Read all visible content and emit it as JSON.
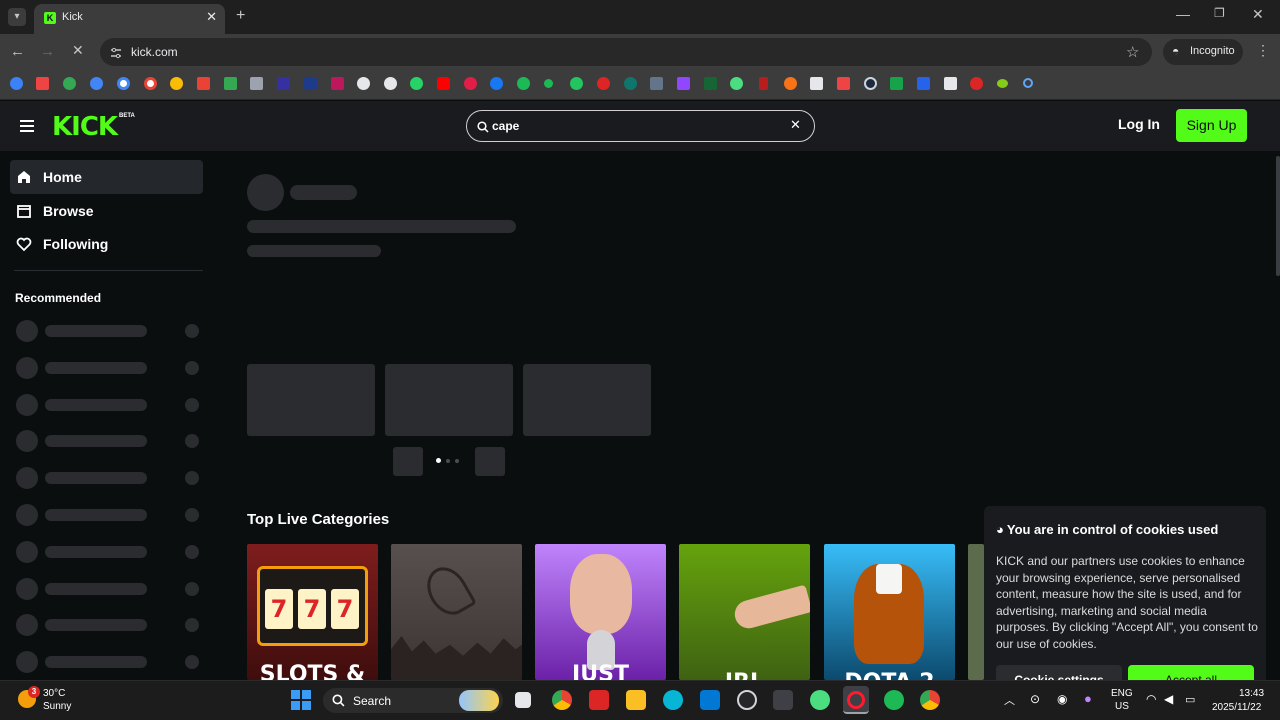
{
  "browser": {
    "tab_title": "Kick",
    "tab_favicon_letter": "K",
    "url": "kick.com",
    "incognito_label": "Incognito"
  },
  "site": {
    "logo": "KICK",
    "logo_badge": "BETA",
    "brand_color": "#53fc18",
    "search_value": "cape",
    "login_label": "Log In",
    "signup_label": "Sign Up"
  },
  "sidebar": {
    "nav": [
      {
        "label": "Home",
        "icon": "home-icon",
        "active": true
      },
      {
        "label": "Browse",
        "icon": "browse-icon",
        "active": false
      },
      {
        "label": "Following",
        "icon": "heart-icon",
        "active": false
      }
    ],
    "recommended_title": "Recommended"
  },
  "main": {
    "categories_title": "Top Live Categories",
    "categories": [
      {
        "text": "SLOTS &"
      },
      {
        "text": ""
      },
      {
        "text": "JUST"
      },
      {
        "text": "IRL"
      },
      {
        "text": "DOTA 2"
      },
      {
        "text": ""
      }
    ]
  },
  "cookie": {
    "title": "You are in control of cookies used",
    "body": "KICK and our partners use cookies to enhance your browsing experience, serve personalised content, measure how the site is used, and for advertising, marketing and social media purposes. By clicking \"Accept All\", you consent to our use of cookies.",
    "settings_label": "Cookie settings",
    "accept_label": "Accept all"
  },
  "taskbar": {
    "weather_temp": "30°C",
    "weather_desc": "Sunny",
    "weather_badge": "3",
    "search_label": "Search",
    "lang_top": "ENG",
    "lang_bottom": "US",
    "time": "13:43",
    "date": "2025/11/22"
  }
}
